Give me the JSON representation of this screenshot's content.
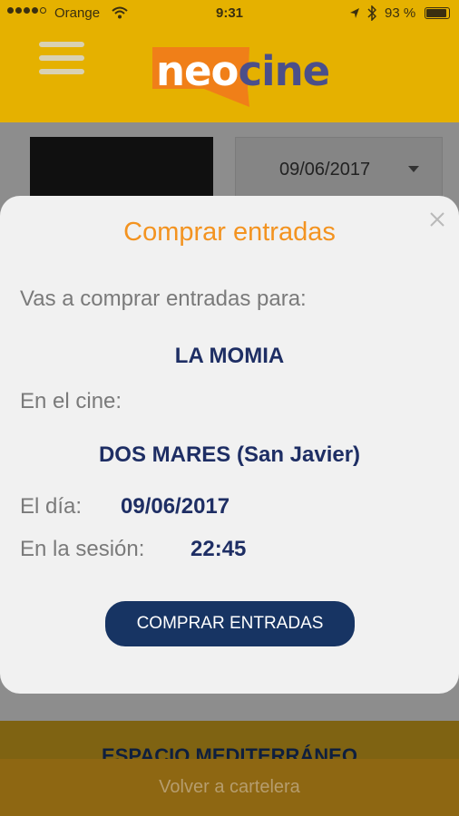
{
  "status_bar": {
    "carrier": "Orange",
    "time": "9:31",
    "battery_text": "93 %",
    "battery_level": 0.93
  },
  "header": {
    "logo_part1": "neo",
    "logo_part2": "cine",
    "colors": {
      "bar": "#e5b100",
      "logo_shape": "#f07f18",
      "logo_cine": "#4b4f8a"
    }
  },
  "background_page": {
    "selected_date": "09/06/2017",
    "cinema_name": "ESPACIO MEDITERRÁNEO"
  },
  "modal": {
    "title": "Comprar entradas",
    "intro": "Vas a comprar entradas para:",
    "movie": "LA MOMIA",
    "cinema_label": "En el cine:",
    "cinema": "DOS MARES (San Javier)",
    "day_label": "El día:",
    "day": "09/06/2017",
    "session_label": "En la sesión:",
    "session": "22:45",
    "button": "COMPRAR ENTRADAS",
    "colors": {
      "title": "#f39320",
      "values": "#1e2e64",
      "button": "#173463"
    }
  },
  "footer": {
    "back_label": "Volver a cartelera"
  }
}
